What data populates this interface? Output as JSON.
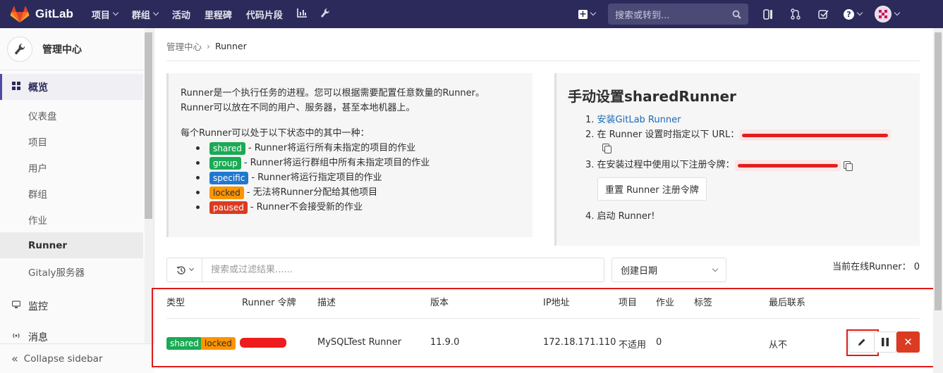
{
  "navbar": {
    "brand": "GitLab",
    "links": [
      {
        "label": "项目",
        "has_caret": true
      },
      {
        "label": "群组",
        "has_caret": true
      },
      {
        "label": "活动",
        "has_caret": false
      },
      {
        "label": "里程碑",
        "has_caret": false
      },
      {
        "label": "代码片段",
        "has_caret": false
      }
    ],
    "search_placeholder": "搜索或转到...",
    "icons": [
      "chart-icon",
      "wrench-icon",
      "plus-icon",
      "search-icon",
      "sidebar-toggle-icon",
      "merge-request-icon",
      "todo-icon",
      "help-icon",
      "avatar"
    ]
  },
  "sidebar": {
    "title": "管理中心",
    "items": [
      {
        "label": "概览",
        "icon": "grid-icon"
      },
      {
        "label": "仪表盘"
      },
      {
        "label": "项目"
      },
      {
        "label": "用户"
      },
      {
        "label": "群组"
      },
      {
        "label": "作业"
      },
      {
        "label": "Runner"
      },
      {
        "label": "Gitaly服务器"
      },
      {
        "label": "监控",
        "icon": "monitor-icon"
      },
      {
        "label": "消息",
        "icon": "broadcast-icon"
      }
    ],
    "collapse_label": "Collapse sidebar"
  },
  "breadcrumb": {
    "parent": "管理中心",
    "current": "Runner"
  },
  "info": {
    "line1": "Runner是一个执行任务的进程。您可以根据需要配置任意数量的Runner。",
    "line2": "Runner可以放在不同的用户、服务器，甚至本地机器上。",
    "states_intro": "每个Runner可以处于以下状态中的其中一种：",
    "states": [
      {
        "badge": "shared",
        "color": "#1aaa55",
        "text": " - Runner将运行所有未指定的项目的作业"
      },
      {
        "badge": "group",
        "color": "#1aaa55",
        "text": " - Runner将运行群组中所有未指定项目的作业"
      },
      {
        "badge": "specific",
        "color": "#1f78d1",
        "text": " - Runner将运行指定项目的作业"
      },
      {
        "badge": "locked",
        "color": "#fc9403",
        "text": " - 无法将Runner分配给其他项目"
      },
      {
        "badge": "paused",
        "color": "#db3b21",
        "text": " - Runner不会接受新的作业"
      }
    ]
  },
  "setup": {
    "title": "手动设置sharedRunner",
    "step1_link": "安装GitLab Runner",
    "step2": "在 Runner 设置时指定以下 URL：",
    "step3": "在安装过程中使用以下注册令牌：",
    "reset_button": "重置 Runner 注册令牌",
    "step4": "启动 Runner!"
  },
  "filter": {
    "placeholder": "搜索或过滤结果......",
    "sort_label": "创建日期",
    "online_label": "当前在线Runner： 0"
  },
  "table": {
    "headers": [
      "类型",
      "Runner 令牌",
      "描述",
      "版本",
      "IP地址",
      "项目",
      "作业",
      "标签",
      "最后联系"
    ],
    "rows": [
      {
        "badges": [
          "shared",
          "locked"
        ],
        "description": "MySQLTest Runner",
        "version": "11.9.0",
        "ip": "172.18.171.110",
        "projects": "不适用",
        "jobs": "0",
        "tags": "",
        "last_contact": "从不"
      }
    ]
  }
}
